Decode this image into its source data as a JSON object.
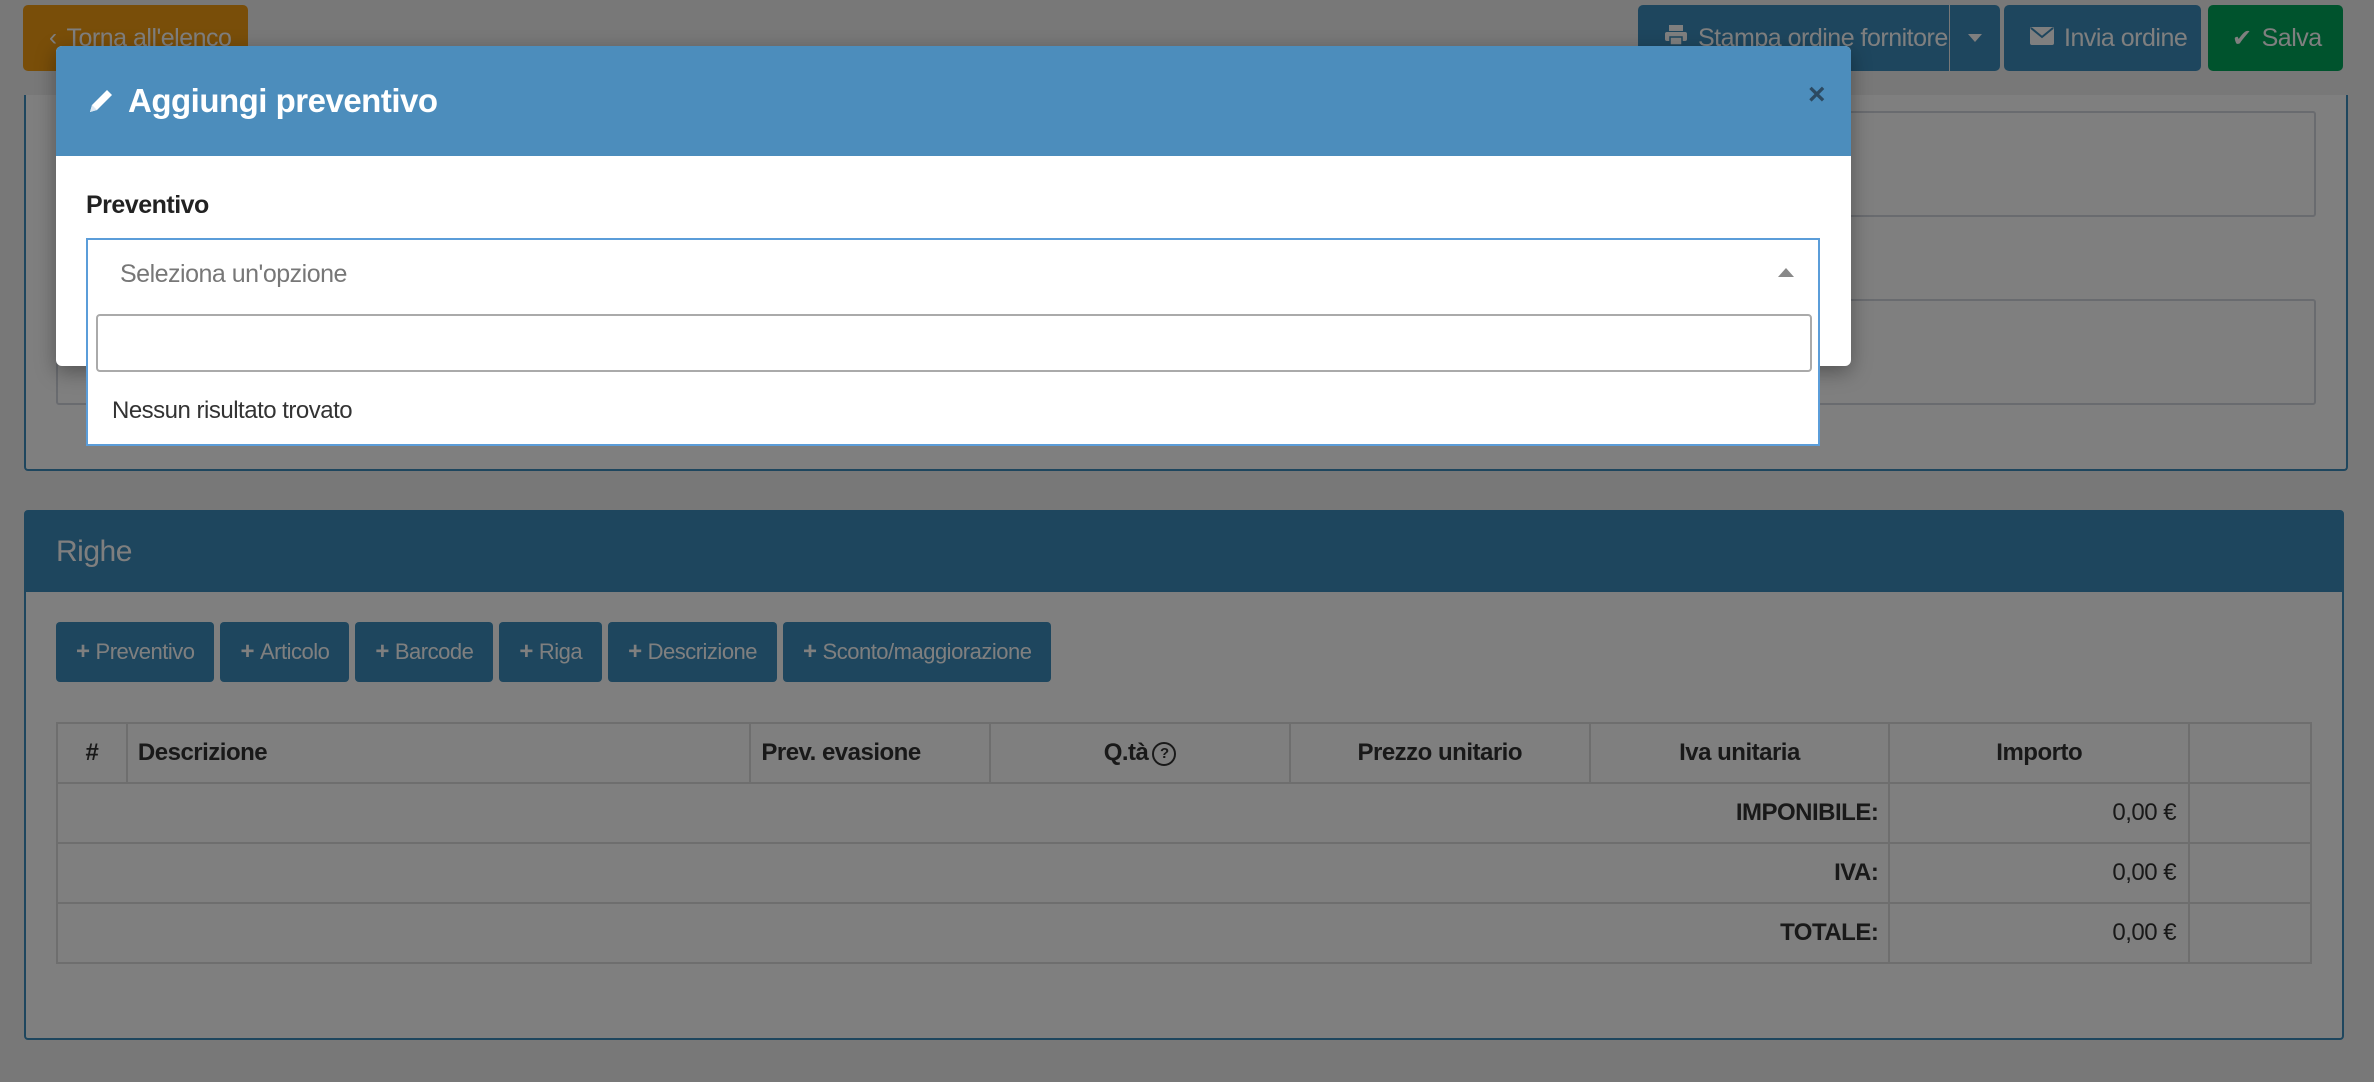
{
  "toolbar": {
    "back_label": "Torna all'elenco",
    "print_label": "Stampa ordine fornitore",
    "send_label": "Invia ordine",
    "save_label": "Salva"
  },
  "righe": {
    "title": "Righe",
    "actions": [
      "Preventivo",
      "Articolo",
      "Barcode",
      "Riga",
      "Descrizione",
      "Sconto/maggiorazione"
    ],
    "columns": [
      "#",
      "Descrizione",
      "Prev. evasione",
      "Q.tà",
      "Prezzo unitario",
      "Iva unitaria",
      "Importo",
      ""
    ],
    "totals": [
      {
        "label": "IMPONIBILE:",
        "value": "0,00 €"
      },
      {
        "label": "IVA:",
        "value": "0,00 €"
      },
      {
        "label": "TOTALE:",
        "value": "0,00 €"
      }
    ]
  },
  "modal": {
    "title": "Aggiungi preventivo",
    "close": "×",
    "field_label": "Preventivo",
    "select_placeholder": "Seleziona un'opzione",
    "search_value": "",
    "no_results": "Nessun risultato trovato"
  },
  "colors": {
    "primary": "#3c8dbc",
    "warning": "#f39c12",
    "success": "#00a65a",
    "modal_header": "#4c8dbc"
  },
  "icons": {
    "back": "chevron-left-icon",
    "print": "print-icon",
    "send": "envelope-icon",
    "save": "check-icon",
    "modal": "pencil-icon",
    "add": "plus-icon",
    "help": "question-circle-icon"
  }
}
